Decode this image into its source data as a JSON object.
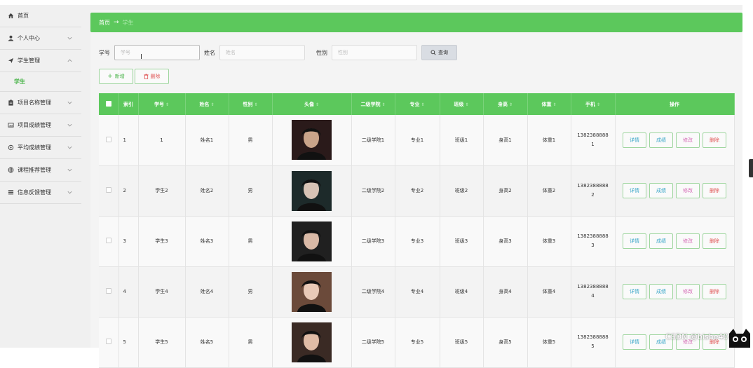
{
  "sidebar": {
    "items": [
      {
        "label": "首页",
        "icon": "home-icon"
      },
      {
        "label": "个人中心",
        "icon": "user-icon"
      },
      {
        "label": "学生管理",
        "icon": "send-icon",
        "expanded": true,
        "sub": [
          {
            "label": "学生"
          }
        ]
      },
      {
        "label": "项目名称管理",
        "icon": "clipboard-icon"
      },
      {
        "label": "项目成绩管理",
        "icon": "image-icon"
      },
      {
        "label": "平均成绩管理",
        "icon": "settings-icon"
      },
      {
        "label": "课程推荐管理",
        "icon": "globe-icon"
      },
      {
        "label": "信息反馈管理",
        "icon": "list-icon"
      }
    ]
  },
  "breadcrumb": {
    "home": "首页",
    "sep": "→",
    "current": "学生"
  },
  "search": {
    "fields": [
      {
        "label": "学号",
        "placeholder": "学号"
      },
      {
        "label": "姓名",
        "placeholder": "姓名"
      },
      {
        "label": "性别",
        "placeholder": "性别"
      }
    ],
    "button": "查询"
  },
  "toolbar": {
    "add": "新增",
    "delete": "删除"
  },
  "table": {
    "columns": [
      "索引",
      "学号",
      "姓名",
      "性别",
      "头像",
      "二级学院",
      "专业",
      "班级",
      "身高",
      "体重",
      "手机",
      "操作"
    ],
    "rows": [
      {
        "index": "1",
        "xuehao": "1",
        "name": "姓名1",
        "gender": "男",
        "college": "二级学院1",
        "major": "专业1",
        "cls": "班级1",
        "height": "身高1",
        "weight": "体重1",
        "phone_a": "1382388888",
        "phone_b": "1"
      },
      {
        "index": "2",
        "xuehao": "学生2",
        "name": "姓名2",
        "gender": "男",
        "college": "二级学院2",
        "major": "专业2",
        "cls": "班级2",
        "height": "身高2",
        "weight": "体重2",
        "phone_a": "1382388888",
        "phone_b": "2"
      },
      {
        "index": "3",
        "xuehao": "学生3",
        "name": "姓名3",
        "gender": "男",
        "college": "二级学院3",
        "major": "专业3",
        "cls": "班级3",
        "height": "身高3",
        "weight": "体重3",
        "phone_a": "1382388888",
        "phone_b": "3"
      },
      {
        "index": "4",
        "xuehao": "学生4",
        "name": "姓名4",
        "gender": "男",
        "college": "二级学院4",
        "major": "专业4",
        "cls": "班级4",
        "height": "身高4",
        "weight": "体重4",
        "phone_a": "1382388888",
        "phone_b": "4"
      },
      {
        "index": "5",
        "xuehao": "学生5",
        "name": "姓名5",
        "gender": "男",
        "college": "二级学院5",
        "major": "专业5",
        "cls": "班级5",
        "height": "身高5",
        "weight": "体重5",
        "phone_a": "1382388888",
        "phone_b": "5"
      }
    ],
    "ops": {
      "detail": "详情",
      "score": "成绩",
      "edit": "修改",
      "remove": "删除"
    }
  },
  "watermark": "CSDN @bishe409"
}
